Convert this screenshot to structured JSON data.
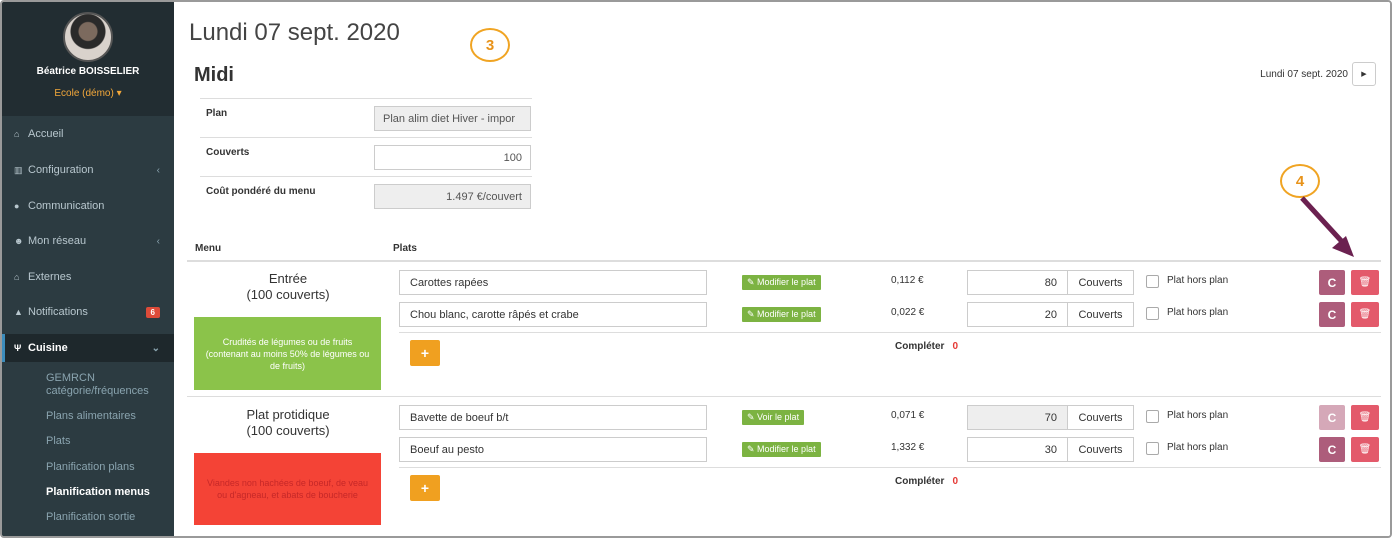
{
  "sidebar": {
    "user_name": "Béatrice BOISSELIER",
    "org": "Ecole (démo) ▾",
    "items": [
      {
        "label": "Accueil",
        "icon": "home-icon"
      },
      {
        "label": "Configuration",
        "icon": "bank-icon",
        "chevron": "‹"
      },
      {
        "label": "Communication",
        "icon": "chat-icon"
      },
      {
        "label": "Mon réseau",
        "icon": "people-icon",
        "chevron": "‹"
      },
      {
        "label": "Externes",
        "icon": "home-icon"
      },
      {
        "label": "Notifications",
        "icon": "bell-icon",
        "badge": "6"
      },
      {
        "label": "Cuisine",
        "icon": "cutlery-icon",
        "chevron": "⌄"
      }
    ],
    "submenu": [
      "GEMRCN catégorie/fréquences",
      "Plans alimentaires",
      "Plats",
      "Planification plans",
      "Planification menus",
      "Planification sortie"
    ]
  },
  "header": {
    "date_title": "Lundi 07 sept. 2020",
    "callout_3": "3",
    "callout_4": "4",
    "section": "Midi",
    "date_nav_label": "Lundi 07 sept. 2020",
    "next_glyph": "▶"
  },
  "info": {
    "plan_label": "Plan",
    "plan_value": "Plan alim diet Hiver - impor",
    "couverts_label": "Couverts",
    "couverts_value": "100",
    "cout_label": "Coût pondéré du menu",
    "cout_value": "1.497 €/couvert"
  },
  "table": {
    "col_menu": "Menu",
    "col_plats": "Plats",
    "complete_label": "Compléter",
    "unit": "Couverts",
    "hors_plan": "Plat hors plan",
    "add_label": "+",
    "re_glyph": "C",
    "del_glyph": "🗑"
  },
  "groups": [
    {
      "title_1": "Entrée",
      "title_2": "(100 couverts)",
      "box_text": "Crudités de légumes ou de fruits (contenant au moins 50% de légumes ou de fruits)",
      "box_color": "#8bc34a",
      "complete_value": "0",
      "dishes": [
        {
          "name": "Carottes rapées",
          "action": "✎ Modifier le plat",
          "price": "0,112 €",
          "qty": "80"
        },
        {
          "name": "Chou blanc, carotte râpés et crabe",
          "action": "✎ Modifier le plat",
          "price": "0,022 €",
          "qty": "20"
        }
      ]
    },
    {
      "title_1": "Plat protidique",
      "title_2": "(100 couverts)",
      "box_text": "Viandes non hachées de boeuf, de veau ou d'agneau, et abats de boucherie",
      "box_color": "#f44336",
      "complete_value": "0",
      "dishes": [
        {
          "name": "Bavette de boeuf b/t",
          "action": "✎ Voir le plat",
          "price": "0,071 €",
          "qty": "70"
        },
        {
          "name": "Boeuf au pesto",
          "action": "✎ Modifier le plat",
          "price": "1,332 €",
          "qty": "30"
        }
      ]
    }
  ]
}
